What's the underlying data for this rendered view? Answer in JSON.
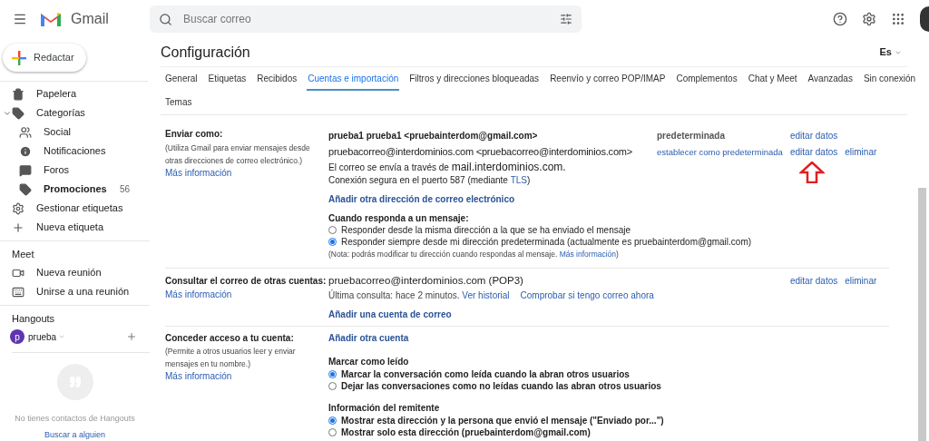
{
  "header": {
    "app_name": "Gmail",
    "search": {
      "placeholder": "Buscar correo"
    }
  },
  "sidebar": {
    "compose": "Redactar",
    "items": [
      {
        "label": "Papelera",
        "kind": "trash"
      },
      {
        "label": "Categorías",
        "kind": "label",
        "expanded": true,
        "children": [
          {
            "label": "Social",
            "kind": "people",
            "unread": false
          },
          {
            "label": "Notificaciones",
            "kind": "info",
            "unread": false
          },
          {
            "label": "Foros",
            "kind": "forum",
            "unread": false
          },
          {
            "label": "Promociones",
            "kind": "tag",
            "unread": true,
            "count": "56"
          }
        ]
      },
      {
        "label": "Gestionar etiquetas",
        "kind": "gear"
      },
      {
        "label": "Nueva etiqueta",
        "kind": "plus"
      }
    ],
    "meet": {
      "title": "Meet",
      "items": [
        {
          "label": "Nueva reunión",
          "kind": "video"
        },
        {
          "label": "Unirse a una reunión",
          "kind": "keyboard"
        }
      ]
    },
    "hangouts": {
      "title": "Hangouts",
      "user": {
        "initial": "p",
        "name": "prueba"
      },
      "empty_text": "No tienes contactos de Hangouts",
      "link": "Buscar a alguien"
    }
  },
  "settings": {
    "title": "Configuración",
    "language": "Es",
    "tab_rows": [
      [
        {
          "label": "General",
          "selected": false
        },
        {
          "label": "Etiquetas",
          "selected": false
        },
        {
          "label": "Recibidos",
          "selected": false
        },
        {
          "label": "Cuentas e importación",
          "selected": true
        },
        {
          "label": "Filtros y direcciones bloqueadas",
          "selected": false
        },
        {
          "label": "Reenvío y correo POP/IMAP",
          "selected": false
        },
        {
          "label": "Complementos",
          "selected": false
        },
        {
          "label": "Chat y Meet",
          "selected": false
        },
        {
          "label": "Avanzadas",
          "selected": false
        },
        {
          "label": "Sin conexión",
          "selected": false
        }
      ],
      [
        {
          "label": "Temas",
          "selected": false
        }
      ]
    ],
    "send_as": {
      "label": "Enviar como:",
      "description": "(Utiliza Gmail para enviar mensajes desde otras direcciones de correo electrónico.)",
      "link": "Más información",
      "accounts": [
        {
          "address": "prueba1 prueba1 <pruebainterdom@gmail.com>",
          "status": "predeterminada",
          "actions": [
            "editar datos"
          ]
        },
        {
          "address": "pruebacorreo@interdominios.com <pruebacorreo@interdominios.com>",
          "set_default": "establecer como predeterminada",
          "actions": [
            "editar datos",
            "eliminar"
          ],
          "via_prefix": "El correo se envía a través de",
          "via_server": "mail.interdominios.com.",
          "secure_before": "Conexión segura en el puerto 587 (mediante",
          "secure_link": "TLS",
          "secure_after": ")"
        }
      ],
      "add_link": "Añadir otra dirección de correo electrónico",
      "reply": {
        "title": "Cuando responda a un mensaje:",
        "options": [
          {
            "label": "Responder desde la misma dirección a la que se ha enviado el mensaje",
            "selected": false
          },
          {
            "label": "Responder siempre desde mi dirección predeterminada (actualmente es pruebainterdom@gmail.com)",
            "selected": true
          }
        ],
        "note_before": "(Nota: podrás modificar tu dirección cuando respondas al mensaje.",
        "note_link": "Más información",
        "note_after": ")"
      }
    },
    "check_mail": {
      "label": "Consultar el correo de otras cuentas:",
      "link": "Más información",
      "account": "pruebacorreo@interdominios.com (POP3)",
      "status": "Última consulta: hace 2 minutos.",
      "links": [
        "Ver historial",
        "Comprobar si tengo correo ahora"
      ],
      "actions": [
        "editar datos",
        "eliminar"
      ],
      "add_link": "Añadir una cuenta de correo"
    },
    "grant_access": {
      "label": "Conceder acceso a tu cuenta:",
      "description": "(Permite a otros usuarios leer y enviar mensajes en tu nombre.)",
      "link": "Más información",
      "add_link": "Añadir otra cuenta",
      "groups": [
        {
          "title": "Marcar como leído",
          "options": [
            {
              "label": "Marcar la conversación como leída cuando la abran otros usuarios",
              "selected": true
            },
            {
              "label": "Dejar las conversaciones como no leídas cuando las abran otros usuarios",
              "selected": false
            }
          ]
        },
        {
          "title": "Información del remitente",
          "options": [
            {
              "label": "Mostrar esta dirección y la persona que envió el mensaje (\"Enviado por...\")",
              "selected": true
            },
            {
              "label": "Mostrar solo esta dirección (pruebainterdom@gmail.com)",
              "selected": false
            }
          ]
        }
      ]
    }
  }
}
